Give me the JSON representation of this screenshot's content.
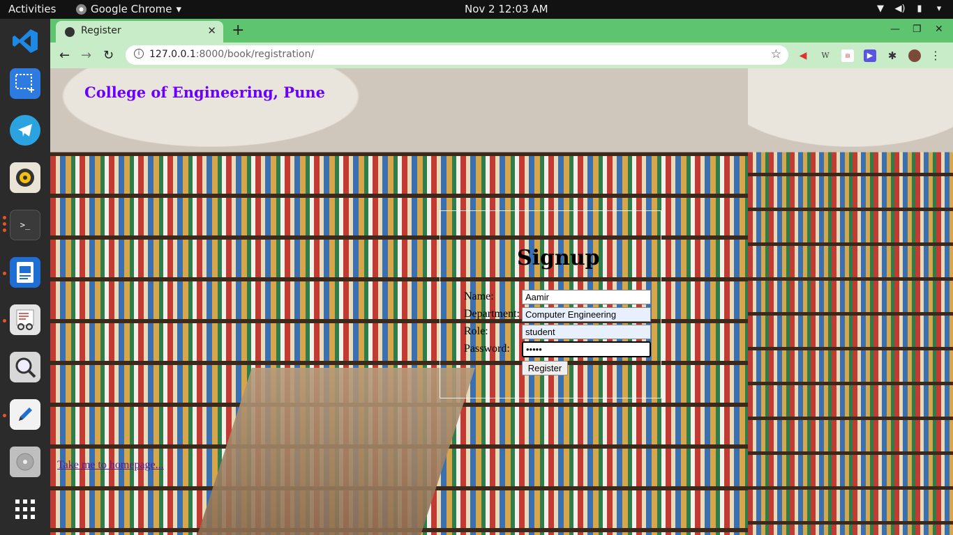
{
  "topbar": {
    "activities": "Activities",
    "app_name": "Google Chrome",
    "datetime": "Nov 2  12:03 AM"
  },
  "dock": {
    "items": [
      {
        "name": "vscode",
        "color": "#1e88e5"
      },
      {
        "name": "screenshot",
        "color": "#2d7be0"
      },
      {
        "name": "telegram",
        "color": "#2aa3e0"
      },
      {
        "name": "rhythmbox",
        "color": "#f4c20d"
      },
      {
        "name": "terminal",
        "color": "#3a3a3a"
      },
      {
        "name": "document-viewer",
        "color": "#1f6ed4"
      },
      {
        "name": "reader",
        "color": "#d8d8d8"
      },
      {
        "name": "image-viewer",
        "color": "#d8d8d8"
      },
      {
        "name": "text-editor",
        "color": "#f2f2f2"
      },
      {
        "name": "disk",
        "color": "#bfbfbf"
      },
      {
        "name": "show-apps",
        "color": "#ffffff"
      }
    ]
  },
  "browser": {
    "tab_title": "Register",
    "url_host": "127.0.0.1",
    "url_rest": ":8000/book/registration/"
  },
  "page": {
    "college_title": "College of Engineering, Pune",
    "signup_heading": "Signup",
    "form": {
      "name_label": "Name:",
      "name_value": "Aamir",
      "department_label": "Department:",
      "department_value": "Computer Engineering",
      "role_label": "Role:",
      "role_value": "student",
      "password_label": "Password:",
      "password_value": "•••••",
      "register_button": "Register"
    },
    "home_link": "Take me to homepage..."
  },
  "colors": {
    "tabstrip": "#5fc46f",
    "toolbar": "#c8ecc8",
    "college_title": "#6a00ff",
    "link": "#551a8b"
  }
}
